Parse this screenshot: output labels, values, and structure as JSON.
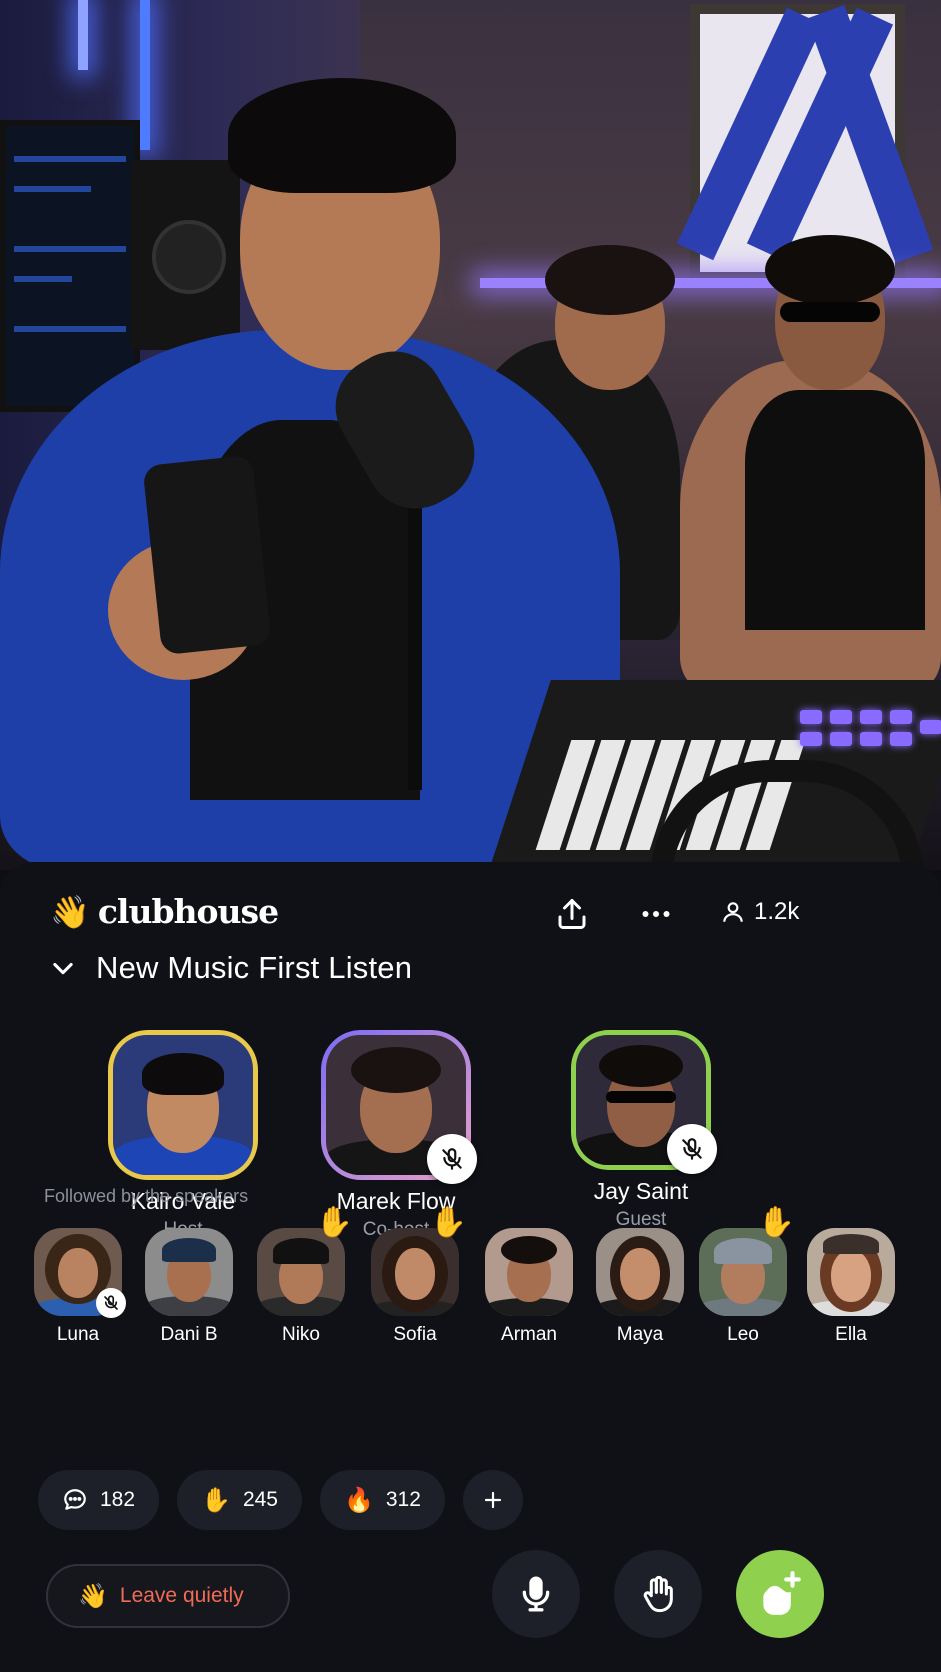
{
  "app": {
    "name": "clubhouse",
    "logo_emoji": "👋"
  },
  "header": {
    "listener_count": "1.2k",
    "share_icon": "share-icon",
    "more_icon": "more-icon",
    "people_icon": "person-icon"
  },
  "room": {
    "title": "New Music First Listen"
  },
  "speakers": [
    {
      "name": "Kairo Vale",
      "role": "Host",
      "ring": "#e8c94a",
      "muted": false
    },
    {
      "name": "Marek Flow",
      "role": "Co-host",
      "ring": "#a77cf3",
      "muted": true
    },
    {
      "name": "Jay Saint",
      "role": "Guest",
      "ring": "#8fd14f",
      "muted": true
    }
  ],
  "followed_label": "Followed by the speakers",
  "listeners": [
    {
      "name": "Luna",
      "hand_raised": false,
      "muted": true
    },
    {
      "name": "Dani B",
      "hand_raised": false,
      "muted": false
    },
    {
      "name": "Niko",
      "hand_raised": true,
      "muted": false
    },
    {
      "name": "Sofia",
      "hand_raised": true,
      "muted": false
    },
    {
      "name": "Arman",
      "hand_raised": false,
      "muted": false
    },
    {
      "name": "Maya",
      "hand_raised": false,
      "muted": false
    },
    {
      "name": "Leo",
      "hand_raised": true,
      "muted": false
    },
    {
      "name": "Ella",
      "hand_raised": false,
      "muted": false
    }
  ],
  "reactions": [
    {
      "icon": "comment-icon",
      "count": "182"
    },
    {
      "icon": "raised-hand-icon",
      "count": "245"
    },
    {
      "icon": "fire-icon",
      "count": "312"
    }
  ],
  "actions": {
    "leave_label": "Leave quietly",
    "leave_emoji": "👋"
  },
  "colors": {
    "accent_green": "#8fd14f",
    "leave_red": "#f06b55",
    "sheet_bg": "#0f1117"
  }
}
